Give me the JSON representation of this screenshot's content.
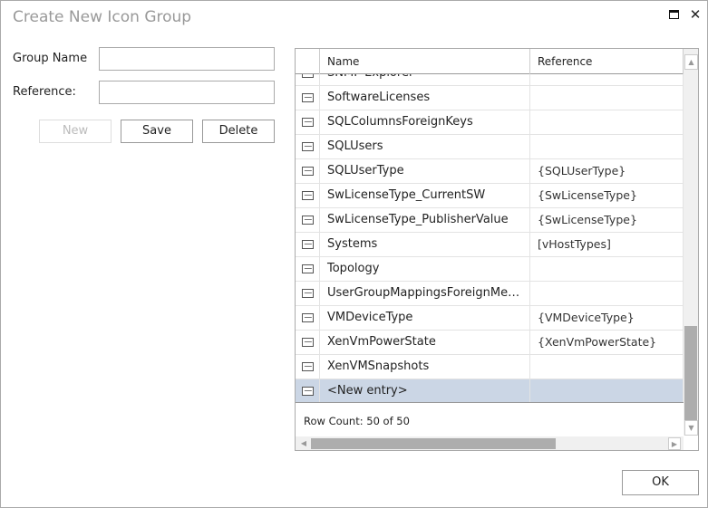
{
  "window": {
    "title": "Create New Icon Group",
    "maximize_icon": "maximize-icon",
    "close_icon": "close-icon"
  },
  "form": {
    "group_name_label": "Group Name",
    "group_name_value": "",
    "reference_label": "Reference:",
    "reference_value": "",
    "new_label": "New",
    "save_label": "Save",
    "delete_label": "Delete"
  },
  "grid": {
    "headers": [
      "Name",
      "Reference"
    ],
    "rows": [
      {
        "name": "SNMP Explorer",
        "reference": ""
      },
      {
        "name": "SoftwareLicenses",
        "reference": ""
      },
      {
        "name": "SQLColumnsForeignKeys",
        "reference": ""
      },
      {
        "name": "SQLUsers",
        "reference": ""
      },
      {
        "name": "SQLUserType",
        "reference": "{SQLUserType}"
      },
      {
        "name": "SwLicenseType_CurrentSW",
        "reference": "{SwLicenseType}"
      },
      {
        "name": "SwLicenseType_PublisherValue",
        "reference": "{SwLicenseType}"
      },
      {
        "name": "Systems",
        "reference": "[vHostTypes]"
      },
      {
        "name": "Topology",
        "reference": ""
      },
      {
        "name": "UserGroupMappingsForeignMembers",
        "reference": ""
      },
      {
        "name": "VMDeviceType",
        "reference": "{VMDeviceType}"
      },
      {
        "name": "XenVmPowerState",
        "reference": "{XenVmPowerState}"
      },
      {
        "name": "XenVMSnapshots",
        "reference": ""
      },
      {
        "name": "<New entry>",
        "reference": "",
        "selected": true
      }
    ],
    "row_count": "Row Count: 50 of 50",
    "selection_color": "#cbd6e5"
  },
  "footer": {
    "ok_label": "OK"
  }
}
